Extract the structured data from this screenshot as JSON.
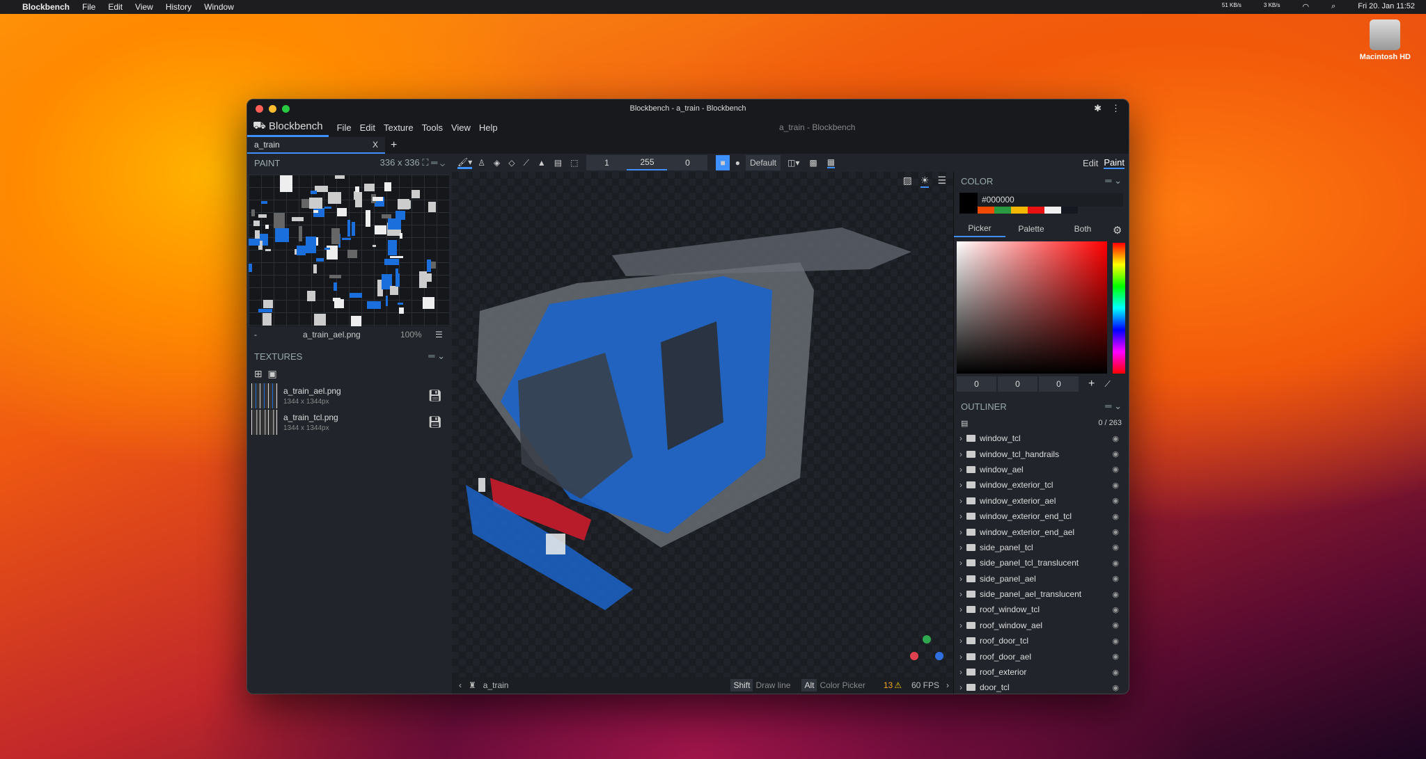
{
  "menubar": {
    "app": "Blockbench",
    "items": [
      "File",
      "Edit",
      "View",
      "History",
      "Window"
    ],
    "net_up": "51 KB/s",
    "net_down": "3 KB/s",
    "clock": "Fri 20. Jan  11:52"
  },
  "desktop": {
    "drive_label": "Macintosh HD"
  },
  "window": {
    "title": "Blockbench - a_train - Blockbench",
    "center_title": "a_train - Blockbench"
  },
  "app_menu": {
    "logo": "Blockbench",
    "items": [
      "File",
      "Edit",
      "Texture",
      "Tools",
      "View",
      "Help"
    ]
  },
  "tab": {
    "label": "a_train",
    "close": "X",
    "add": "+"
  },
  "toolbar": {
    "value1": "1",
    "value2": "255",
    "value3": "0",
    "blend_mode": "Default",
    "modes": [
      "Edit",
      "Paint"
    ]
  },
  "paint": {
    "title": "PAINT",
    "size": "336 x 336",
    "dash": "-",
    "texture_name": "a_train_ael.png",
    "zoom": "100%"
  },
  "textures": {
    "title": "TEXTURES",
    "items": [
      {
        "name": "a_train_ael.png",
        "size": "1344 x 1344px"
      },
      {
        "name": "a_train_tcl.png",
        "size": "1344 x 1344px"
      }
    ]
  },
  "color": {
    "title": "COLOR",
    "hex": "#000000",
    "tabs": [
      "Picker",
      "Palette",
      "Both"
    ],
    "r": "0",
    "g": "0",
    "b": "0",
    "swatches": [
      "#f04a00",
      "#2a9a40",
      "#f5b800",
      "#e81010",
      "#f0f0f0",
      "#151820"
    ]
  },
  "outliner": {
    "title": "OUTLINER",
    "count": "0 / 263",
    "items": [
      "window_tcl",
      "window_tcl_handrails",
      "window_ael",
      "window_exterior_tcl",
      "window_exterior_ael",
      "window_exterior_end_tcl",
      "window_exterior_end_ael",
      "side_panel_tcl",
      "side_panel_tcl_translucent",
      "side_panel_ael",
      "side_panel_ael_translucent",
      "roof_window_tcl",
      "roof_window_ael",
      "roof_door_tcl",
      "roof_door_ael",
      "roof_exterior",
      "door_tcl"
    ]
  },
  "status": {
    "model": "a_train",
    "shift_key": "Shift",
    "shift_action": "Draw line",
    "alt_key": "Alt",
    "alt_action": "Color Picker",
    "warnings": "13",
    "fps": "60 FPS"
  }
}
